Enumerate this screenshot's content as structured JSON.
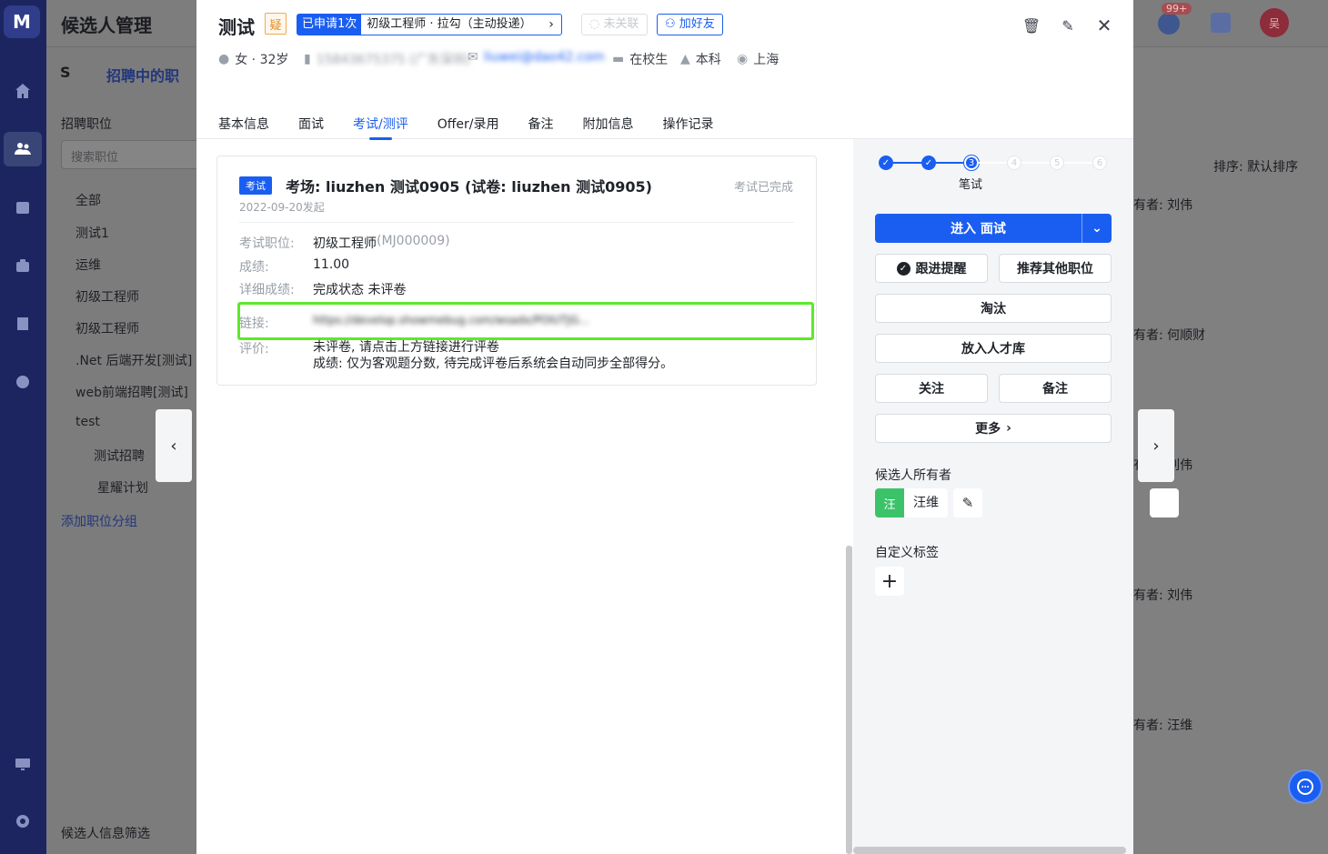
{
  "app": {
    "page_title": "候选人管理",
    "notif_count": "99+",
    "user_avatar": "吴",
    "nav_recruiting": "招聘中的职",
    "sidebar_title": "招聘职位",
    "sidebar_search_placeholder": "搜索职位",
    "tree": [
      "全部",
      "测试1",
      "运维",
      "初级工程师",
      "初级工程师",
      ".Net 后端开发[测试]",
      "web前端招聘[测试]",
      "test",
      "测试招聘",
      "星耀计划"
    ],
    "add_group": "添加职位分组",
    "filter": "候选人信息筛选",
    "sort": "排序: 默认排序",
    "owners_bg": [
      "有者: 刘伟",
      "有者: 何顺财",
      "有者: 刘伟",
      "有者: 刘伟",
      "有者: 汪维"
    ]
  },
  "candidate": {
    "name": "测试",
    "doubt_tag": "疑",
    "applied": "已申请1次",
    "position": "初级工程师 · 拉勾（主动投递）",
    "unlinked": "未关联",
    "add_friend": "加好友",
    "gender_age": "女 · 32岁",
    "phone": "15843675375 (广东深圳)",
    "email": "liuwei@dao42.com",
    "status": "在校生",
    "degree": "本科",
    "city": "上海"
  },
  "tabs": [
    "基本信息",
    "面试",
    "考试/测评",
    "Offer/录用",
    "备注",
    "附加信息",
    "操作记录"
  ],
  "exam": {
    "tag": "考试",
    "title": "考场: liuzhen 测试0905 (试卷: liuzhen 测试0905)",
    "status": "考试已完成",
    "date": "2022-09-20发起",
    "rows": [
      {
        "k": "考试职位:",
        "v": "初级工程师",
        "extra": "(MJ000009)"
      },
      {
        "k": "成绩:",
        "v": "11.00"
      },
      {
        "k": "详细成绩:",
        "v": "完成状态 未评卷"
      },
      {
        "k": "链接:",
        "v": "https://develop.showmebug.com/wsadx/POIUTJG..."
      },
      {
        "k": "评价:",
        "v": "未评卷, 请点击上方链接进行评卷",
        "v2": "成绩: 仅为客观题分数, 待完成评卷后系统会自动同步全部得分。"
      }
    ]
  },
  "right": {
    "steps": [
      "",
      "",
      "3",
      "4",
      "5",
      "6"
    ],
    "step_label": "笔试",
    "enter": "进入 面试",
    "follow_remind": "跟进提醒",
    "recommend": "推荐其他职位",
    "eliminate": "淘汰",
    "to_pool": "放入人才库",
    "watch": "关注",
    "note": "备注",
    "more": "更多",
    "owner_label": "候选人所有者",
    "owner_avatar": "汪",
    "owner_name": "汪维",
    "tags_label": "自定义标签"
  },
  "colors": {
    "accent": "#1a5ef1",
    "highlight": "#5de92a",
    "owner": "#3cc36a"
  }
}
